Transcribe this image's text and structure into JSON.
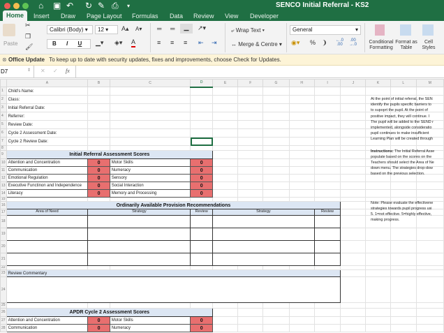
{
  "window": {
    "title": "SENCO Initial Referral - KS2"
  },
  "tabs": [
    "Home",
    "Insert",
    "Draw",
    "Page Layout",
    "Formulas",
    "Data",
    "Review",
    "View",
    "Developer"
  ],
  "ribbon": {
    "paste": "Paste",
    "font": "Calibri (Body)",
    "size": "12",
    "bold": "B",
    "italic": "I",
    "underline": "U",
    "font_color": "A",
    "grow": "A",
    "shrink": "A",
    "wrap_text": "Wrap Text",
    "merge_centre": "Merge & Centre",
    "number_format": "General",
    "percent": "%",
    "comma": "",
    "conditional": "Conditional Formatting",
    "format_table": "Format as Table",
    "cell_styles": "Cell Styles"
  },
  "update": {
    "title": "Office Update",
    "message": "To keep up to date with security updates, fixes and improvements, choose Check for Updates."
  },
  "formula": {
    "name_box": "D7",
    "fx": "fx",
    "value": ""
  },
  "columns": [
    "A",
    "B",
    "C",
    "D",
    "E",
    "F",
    "G",
    "H",
    "I",
    "J",
    "K",
    "L",
    "M"
  ],
  "rows": [
    "1",
    "2",
    "3",
    "4",
    "5",
    "6",
    "7",
    "8",
    "9",
    "10",
    "11",
    "12",
    "13",
    "14",
    "15",
    "16",
    "17",
    "18",
    "19",
    "20",
    "21",
    "22",
    "23",
    "24",
    "25",
    "26",
    "27",
    "28"
  ],
  "sheet": {
    "info_labels": [
      "Child's Name:",
      "Class:",
      "Initial Referral Date:",
      "Referrer:",
      "Review Date:",
      "Cycle 2 Assessment Date:",
      "Cycle 2 Review Date:"
    ],
    "initial_title": "Initial Referral Assessment Scores",
    "scores": [
      {
        "left": "Attention and Concentration",
        "lv": "0",
        "right": "Motor Skills",
        "rv": "0"
      },
      {
        "left": "Communication",
        "lv": "0",
        "right": "Numeracy",
        "rv": "0"
      },
      {
        "left": "Emotional Regulation",
        "lv": "0",
        "right": "Sensory",
        "rv": "0"
      },
      {
        "left": "Executive Functinon and Independence",
        "lv": "0",
        "right": "Social Interaction",
        "rv": "0"
      },
      {
        "left": "Literacy",
        "lv": "0",
        "right": "Memory and Processing",
        "rv": "0"
      }
    ],
    "oap_title": "Ordinarily Available Provision Recommendations",
    "oap_headers": [
      "Area of Need",
      "Strategy",
      "Review",
      "Strategy",
      "Review"
    ],
    "review_commentary": "Review Commentary",
    "cycle2_title": "APDR Cycle 2 Assessment Scores",
    "cycle2_scores": [
      {
        "left": "Attention and Concentration",
        "lv": "0",
        "right": "Motor Skills",
        "rv": "0"
      },
      {
        "left": "Communication",
        "lv": "0",
        "right": "Numeracy",
        "rv": "0"
      }
    ]
  },
  "notes": {
    "intro": [
      "At the point of initial referral, the SEN",
      "identify the pupils specific barriers to",
      "to supoprt the pupil. At the point of",
      "positive impact, they will continue. I",
      "The pupil will be added to the SEND r",
      "implemented, alongside consideratio",
      "pupil continues to make insufficient",
      "Learning Plan will be created through"
    ],
    "instructions_label": "Instructions:",
    "instructions": [
      " The Initial Referral Asse",
      "populate based on the scores on the",
      "Teachers should select the Area of Ne",
      "down menu. The strategies drop-dow",
      "based on the previous selection."
    ],
    "note": [
      "Note: Please evaluate the effectivene",
      "strategies towards pupil progress usi",
      "5.  1=not effective. 5=highly effective,",
      "making progress."
    ]
  }
}
